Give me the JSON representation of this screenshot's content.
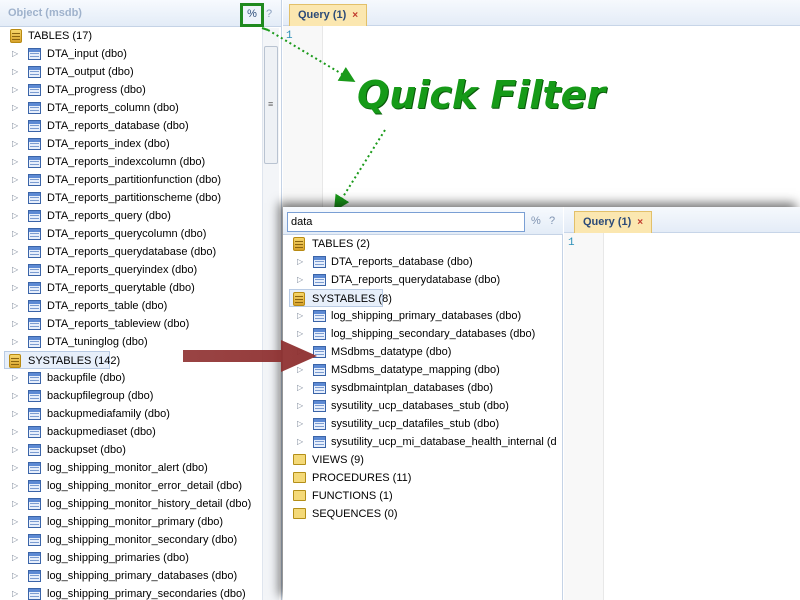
{
  "left_panel": {
    "title": "Object (msdb)",
    "filter_button": "%",
    "help": "?",
    "tables_group": "TABLES (17)",
    "tables": [
      "DTA_input (dbo)",
      "DTA_output (dbo)",
      "DTA_progress (dbo)",
      "DTA_reports_column (dbo)",
      "DTA_reports_database (dbo)",
      "DTA_reports_index (dbo)",
      "DTA_reports_indexcolumn (dbo)",
      "DTA_reports_partitionfunction (dbo)",
      "DTA_reports_partitionscheme (dbo)",
      "DTA_reports_query (dbo)",
      "DTA_reports_querycolumn (dbo)",
      "DTA_reports_querydatabase (dbo)",
      "DTA_reports_queryindex (dbo)",
      "DTA_reports_querytable (dbo)",
      "DTA_reports_table (dbo)",
      "DTA_reports_tableview (dbo)",
      "DTA_tuninglog (dbo)"
    ],
    "systables_group": "SYSTABLES (142)",
    "systables": [
      "backupfile (dbo)",
      "backupfilegroup (dbo)",
      "backupmediafamily (dbo)",
      "backupmediaset (dbo)",
      "backupset (dbo)",
      "log_shipping_monitor_alert (dbo)",
      "log_shipping_monitor_error_detail (dbo)",
      "log_shipping_monitor_history_detail (dbo)",
      "log_shipping_monitor_primary (dbo)",
      "log_shipping_monitor_secondary (dbo)",
      "log_shipping_primaries (dbo)",
      "log_shipping_primary_databases (dbo)",
      "log_shipping_primary_secondaries (dbo)"
    ]
  },
  "query_tab": {
    "label": "Query (1)",
    "close": "×",
    "line_number": "1"
  },
  "callout": "Quick Filter",
  "popup": {
    "filter_value": "data",
    "filter_button": "%",
    "help": "?",
    "tables_group": "TABLES (2)",
    "tables": [
      "DTA_reports_database (dbo)",
      "DTA_reports_querydatabase (dbo)"
    ],
    "systables_group": "SYSTABLES (8)",
    "systables": [
      "log_shipping_primary_databases (dbo)",
      "log_shipping_secondary_databases (dbo)",
      "MSdbms_datatype (dbo)",
      "MSdbms_datatype_mapping (dbo)",
      "sysdbmaintplan_databases (dbo)",
      "sysutility_ucp_databases_stub (dbo)",
      "sysutility_ucp_datafiles_stub (dbo)",
      "sysutility_ucp_mi_database_health_internal (d"
    ],
    "groups": [
      "VIEWS (9)",
      "PROCEDURES (11)",
      "FUNCTIONS (1)",
      "SEQUENCES (0)"
    ]
  },
  "colors": {
    "accent_green": "#169a18",
    "highlight_box": "#1f8a1f",
    "tab_bg": "#fbe7b0",
    "arrow_red": "#8e2f2f"
  }
}
